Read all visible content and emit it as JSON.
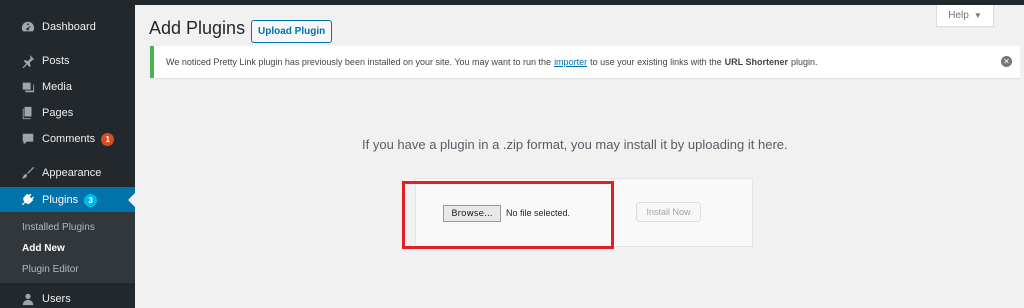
{
  "sidebar": {
    "items": [
      {
        "label": "Dashboard",
        "icon": "dashboard-icon"
      },
      {
        "label": "Posts",
        "icon": "pin-icon"
      },
      {
        "label": "Media",
        "icon": "media-icon"
      },
      {
        "label": "Pages",
        "icon": "pages-icon"
      },
      {
        "label": "Comments",
        "icon": "comment-icon",
        "badge": "1"
      },
      {
        "label": "Appearance",
        "icon": "brush-icon"
      },
      {
        "label": "Plugins",
        "icon": "plugin-icon",
        "badge": "3"
      },
      {
        "label": "Users",
        "icon": "user-icon"
      }
    ],
    "submenu": [
      "Installed Plugins",
      "Add New",
      "Plugin Editor"
    ]
  },
  "header": {
    "title": "Add Plugins",
    "upload_label": "Upload Plugin",
    "help_label": "Help"
  },
  "notice": {
    "text_before": "We noticed Pretty Link plugin has previously been installed on your site. You may want to run the",
    "link": "importer",
    "text_middle": "to use your existing links with the",
    "bold": "URL Shortener",
    "text_after": "plugin."
  },
  "upload": {
    "hint": "If you have a plugin in a .zip format, you may install it by uploading it here.",
    "browse_label": "Browse...",
    "file_status": "No file selected.",
    "install_label": "Install Now"
  },
  "colors": {
    "sidebar_bg": "#23282d",
    "active_bg": "#0073aa",
    "notice_border": "#46b450",
    "highlight": "#e31e24"
  }
}
